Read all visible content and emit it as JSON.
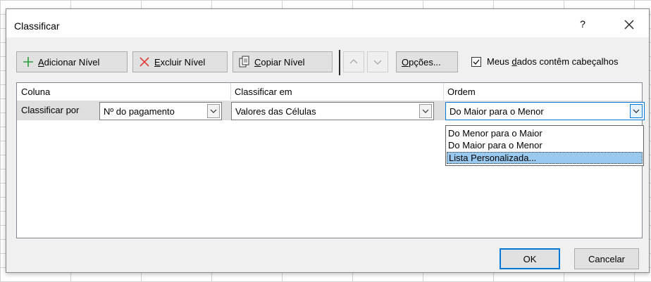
{
  "dialog": {
    "title": "Classificar",
    "help_label": "?"
  },
  "toolbar": {
    "add_prefix": "",
    "add_underline": "A",
    "add_rest": "dicionar Nível",
    "delete_underline": "E",
    "delete_rest": "xcluir Nível",
    "copy_underline": "C",
    "copy_rest": "opiar Nível",
    "options_underline": "O",
    "options_rest": "pções...",
    "header_checkbox_prefix": "Meus ",
    "header_checkbox_underline": "d",
    "header_checkbox_rest": "ados contêm cabeçalhos",
    "header_checkbox_checked": true
  },
  "grid": {
    "headers": {
      "column": "Coluna",
      "sort_on": "Classificar em",
      "order": "Ordem"
    },
    "row": {
      "label": "Classificar por",
      "column_value": "Nº do pagamento",
      "sort_on_value": "Valores das Células",
      "order_value": "Do Maior para o Menor"
    }
  },
  "order_dropdown": {
    "options": [
      "Do Menor para o Maior",
      "Do Maior para o Menor",
      "Lista Personalizada..."
    ],
    "highlighted_index": 2
  },
  "buttons": {
    "ok": "OK",
    "cancel": "Cancelar"
  },
  "colors": {
    "accent": "#0078d7",
    "selection": "#99c9ef",
    "add_icon": "#2e9e3c",
    "delete_icon": "#e03c3c"
  }
}
